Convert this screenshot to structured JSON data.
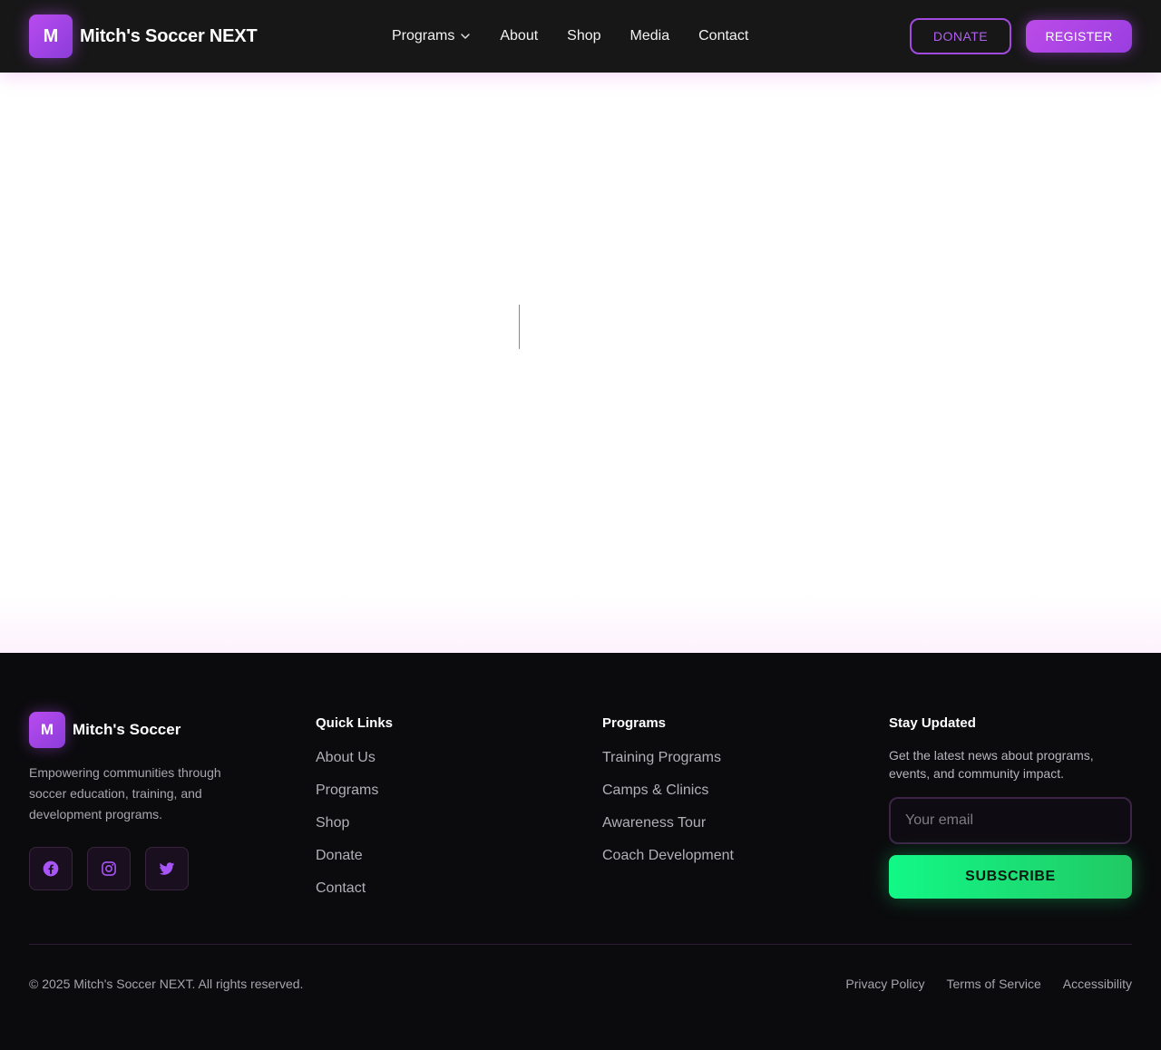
{
  "header": {
    "logo_letter": "M",
    "brand_name": "Mitch's Soccer NEXT",
    "nav": [
      {
        "label": "Programs",
        "has_dropdown": true
      },
      {
        "label": "About"
      },
      {
        "label": "Shop"
      },
      {
        "label": "Media"
      },
      {
        "label": "Contact"
      }
    ],
    "donate_label": "DONATE",
    "register_label": "REGISTER"
  },
  "footer": {
    "logo_letter": "M",
    "brand_name": "Mitch's Soccer",
    "tagline": "Empowering communities through soccer education, training, and development programs.",
    "socials": [
      {
        "icon": "facebook-icon"
      },
      {
        "icon": "instagram-icon"
      },
      {
        "icon": "twitter-icon"
      }
    ],
    "quick_links": {
      "title": "Quick Links",
      "items": [
        "About Us",
        "Programs",
        "Shop",
        "Donate",
        "Contact"
      ]
    },
    "programs": {
      "title": "Programs",
      "items": [
        "Training Programs",
        "Camps & Clinics",
        "Awareness Tour",
        "Coach Development"
      ]
    },
    "newsletter": {
      "title": "Stay Updated",
      "text": "Get the latest news about programs, events, and community impact.",
      "email_placeholder": "Your email",
      "subscribe_label": "SUBSCRIBE"
    },
    "copyright": "© 2025 Mitch's Soccer NEXT. All rights reserved.",
    "legal_links": [
      "Privacy Policy",
      "Terms of Service",
      "Accessibility"
    ]
  },
  "colors": {
    "accent_purple": "#a855f7",
    "accent_green": "#12f887",
    "header_bg": "#171717",
    "footer_bg": "#0b0b0d"
  }
}
